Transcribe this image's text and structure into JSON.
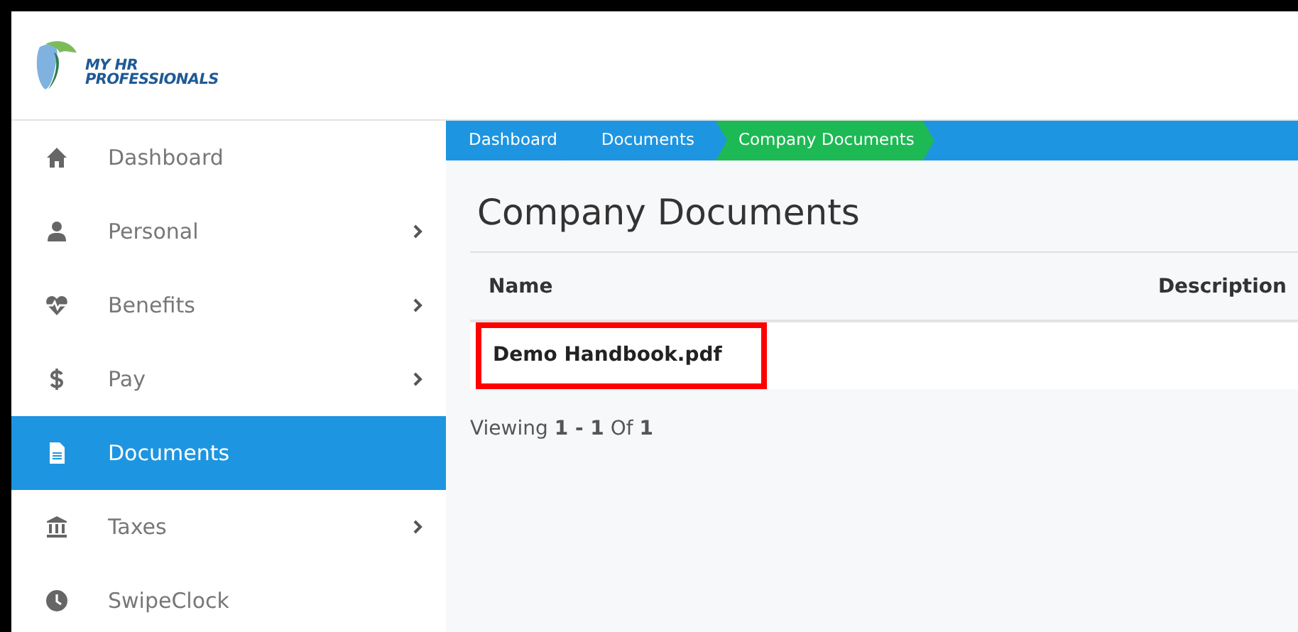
{
  "logo": {
    "line_1": "MY HR",
    "line_2": "PROFESSIONALS"
  },
  "sidebar": {
    "items": [
      {
        "kind": "home",
        "label": "Dashboard",
        "submenu": false,
        "selected": false
      },
      {
        "kind": "person",
        "label": "Personal",
        "submenu": true,
        "selected": false
      },
      {
        "kind": "heart",
        "label": "Benefits",
        "submenu": true,
        "selected": false
      },
      {
        "kind": "dollar",
        "label": "Pay",
        "submenu": true,
        "selected": false
      },
      {
        "kind": "file",
        "label": "Documents",
        "submenu": false,
        "selected": true
      },
      {
        "kind": "bank",
        "label": "Taxes",
        "submenu": true,
        "selected": false
      },
      {
        "kind": "clock",
        "label": "SwipeClock",
        "submenu": false,
        "selected": false
      }
    ]
  },
  "breadcrumb": [
    {
      "label": "Dashboard",
      "selected": false
    },
    {
      "label": "Documents",
      "selected": false
    },
    {
      "label": "Company Documents",
      "selected": true
    }
  ],
  "page_title": "Company Documents",
  "table": {
    "columns": [
      "Name",
      "Description"
    ],
    "rows": [
      {
        "name": "Demo Handbook.pdf",
        "highlighted": true
      }
    ]
  },
  "pager": "Viewing **1 - 1** Of **1**"
}
